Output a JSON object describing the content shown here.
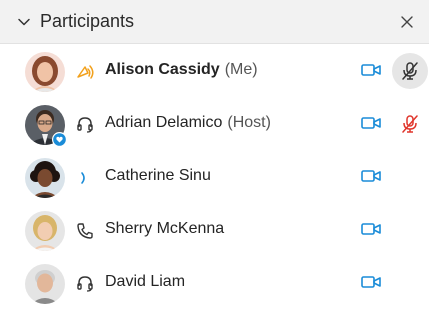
{
  "header": {
    "title": "Participants"
  },
  "participants": [
    {
      "name": "Alison Cassidy",
      "suffix": "(Me)",
      "bold": true,
      "status_icon": "speaking-icon",
      "mic": "muted-icon"
    },
    {
      "name": "Adrian Delamico",
      "suffix": "(Host)",
      "bold": false,
      "status_icon": "headset-icon",
      "host": true,
      "mic": "muted-icon"
    },
    {
      "name": "Catherine Sinu",
      "suffix": "",
      "bold": false,
      "status_icon": "speaking-icon"
    },
    {
      "name": "Sherry McKenna",
      "suffix": "",
      "bold": false,
      "status_icon": "phone-icon"
    },
    {
      "name": "David Liam",
      "suffix": "",
      "bold": false,
      "status_icon": "headset-icon"
    }
  ],
  "colors": {
    "accent": "#1a8cd8",
    "muted": "#e0352b",
    "speaking_orange": "#f2a11d",
    "host_badge": "#1a8cd8"
  }
}
